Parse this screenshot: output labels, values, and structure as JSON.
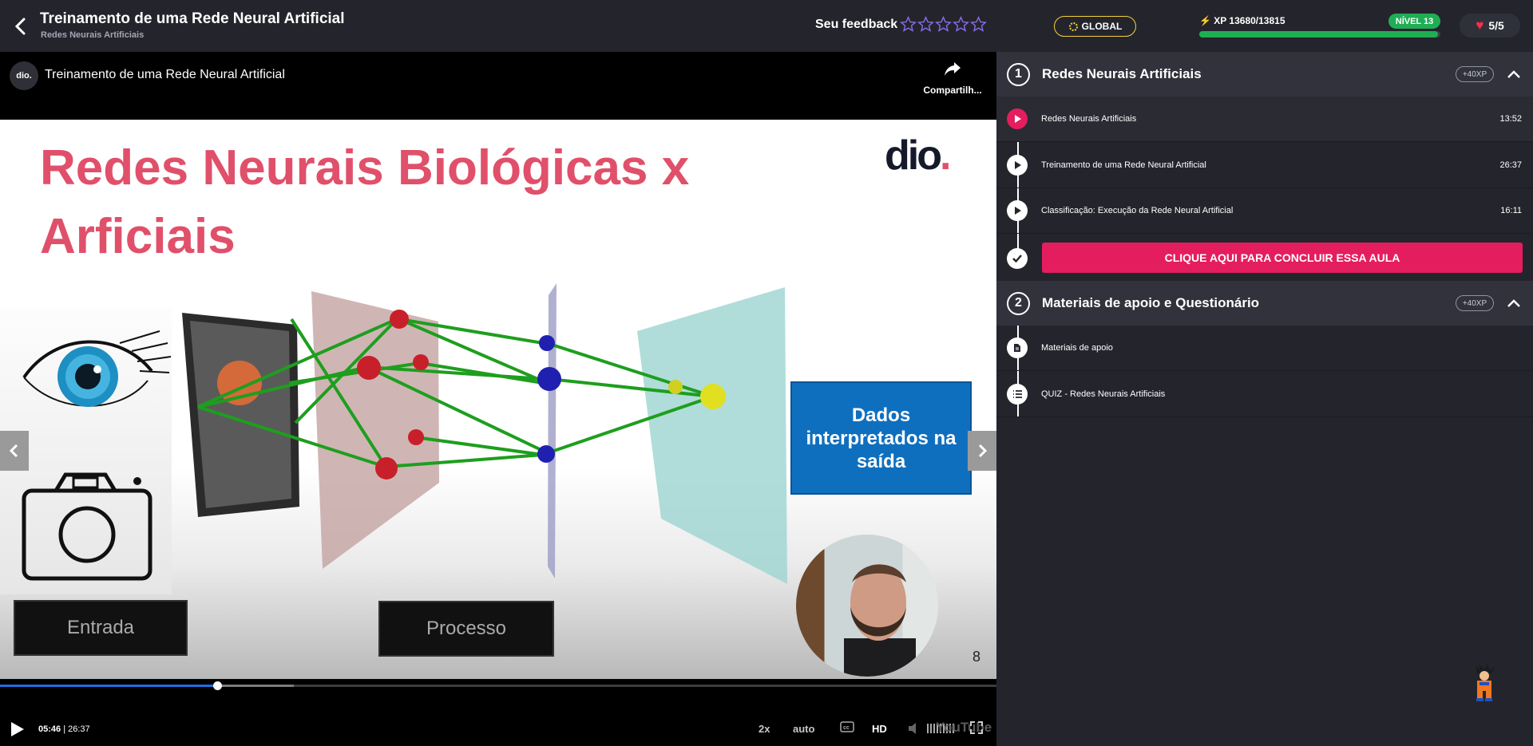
{
  "header": {
    "title": "Treinamento de uma Rede Neural Artificial",
    "subtitle": "Redes Neurais Artificiais",
    "feedback_label": "Seu feedback",
    "rating": 0,
    "rating_max": 5
  },
  "video": {
    "channel_logo": "dio.",
    "title": "Treinamento de uma Rede Neural Artificial",
    "share_label": "Compartilh...",
    "slide": {
      "title": "Redes Neurais Biológicas x Arficiais",
      "logo": "dio.",
      "box_input": "Entrada",
      "box_process": "Processo",
      "box_output": "Dados interpretados na saída",
      "page_number": "8"
    },
    "progress_fraction": 0.2182,
    "buffer_fraction": 0.295,
    "current_time": "05:46",
    "separator": "|",
    "duration": "26:37",
    "speed": "2x",
    "quality_mode": "auto",
    "hd_label": "HD",
    "yt_mark": "YouTube"
  },
  "stats": {
    "global_label": "GLOBAL",
    "xp_label": "XP 13680/13815",
    "xp_fraction": 0.99,
    "level_label": "NÍVEL 13",
    "lives": "5/5"
  },
  "sections": [
    {
      "number": "1",
      "title": "Redes Neurais Artificiais",
      "xp": "+40XP",
      "lessons": [
        {
          "title": "Redes Neurais Artificiais",
          "duration": "13:52",
          "state": "playing"
        },
        {
          "title": "Treinamento de uma Rede Neural Artificial",
          "duration": "26:37",
          "state": "play"
        },
        {
          "title": "Classificação: Execução da Rede Neural Artificial",
          "duration": "16:11",
          "state": "play"
        }
      ],
      "complete_button": "CLIQUE AQUI PARA CONCLUIR ESSA AULA"
    },
    {
      "number": "2",
      "title": "Materiais de apoio e Questionário",
      "xp": "+40XP",
      "lessons": [
        {
          "title": "Materiais de apoio",
          "icon": "document-icon"
        },
        {
          "title": "QUIZ - Redes Neurais Artificiais",
          "icon": "list-icon"
        }
      ]
    }
  ],
  "colors": {
    "accent": "#e41d5f",
    "green": "#1fae54",
    "gold": "#f5d23a",
    "slide_title": "#e0506a",
    "panel_bg": "#24252c"
  }
}
